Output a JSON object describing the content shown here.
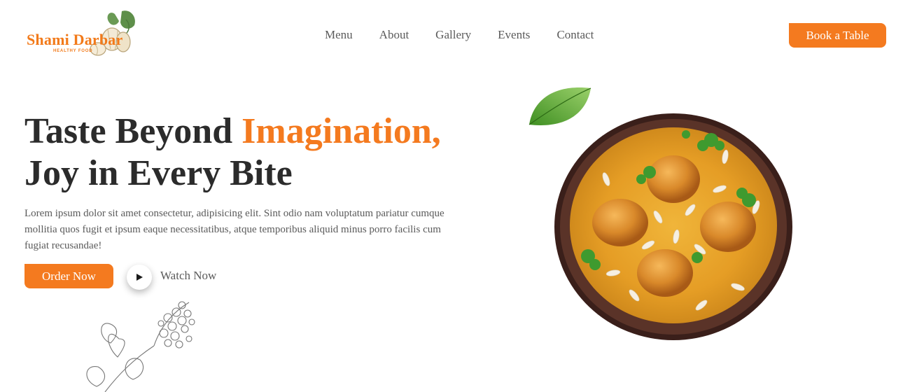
{
  "header": {
    "logo_name": "Shami Darbar",
    "logo_tagline": "HEALTHY FOOD",
    "nav": [
      {
        "label": "Menu"
      },
      {
        "label": "About"
      },
      {
        "label": "Gallery"
      },
      {
        "label": "Events"
      },
      {
        "label": "Contact"
      }
    ],
    "book_label": "Book a Table"
  },
  "hero": {
    "headline_part1": "Taste Beyond ",
    "headline_accent": "Imagination,",
    "headline_line2": "Joy in Every Bite",
    "description": "Lorem ipsum dolor sit amet consectetur, adipisicing elit. Sint odio nam voluptatum pariatur cumque mollitia quos fugit et ipsum eaque necessitatibus, atque temporibus aliquid minus porro facilis cum fugiat recusandae!",
    "order_label": "Order Now",
    "watch_label": "Watch Now"
  },
  "colors": {
    "accent": "#f47a1f",
    "heading": "#2b2b2b",
    "text": "#5a5a5a"
  },
  "icons": {
    "play": "play-icon",
    "logo": "garlic-leaf-logo-icon"
  }
}
